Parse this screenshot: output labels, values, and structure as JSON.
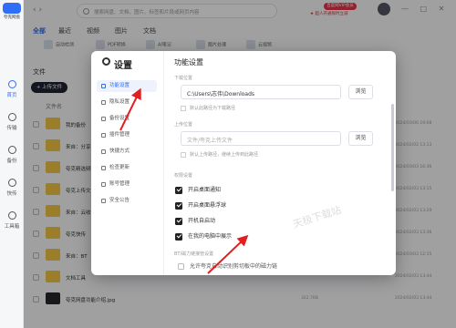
{
  "app": {
    "logo_text": "夸克网盘"
  },
  "sidebar": {
    "items": [
      {
        "label": "首页",
        "icon": "home-icon"
      },
      {
        "label": "传输",
        "icon": "transfer-icon"
      },
      {
        "label": "备份",
        "icon": "backup-icon"
      },
      {
        "label": "快传",
        "icon": "quick-share-icon"
      },
      {
        "label": "工具箱",
        "icon": "toolbox-icon"
      }
    ]
  },
  "topbar": {
    "search_placeholder": "搜索网盘、文档、图片、标签和片段或网页内容",
    "vip_badge": "百度网VIP会员",
    "promo": "★ 超人开通限时立减"
  },
  "tabs": [
    "全部",
    "最近",
    "视频",
    "图片",
    "文档"
  ],
  "chips": [
    "自动检测",
    "PDF转换",
    "AI笔记",
    "图片处理",
    "云视频"
  ],
  "files": {
    "title": "文件",
    "upload_button": "+ 上传文件",
    "column_name": "文件名",
    "rows": [
      {
        "name": "我的备份",
        "date": "2024/03/06 19:08",
        "size": ""
      },
      {
        "name": "来自：分享",
        "date": "2024/02/02 13:13",
        "size": ""
      },
      {
        "name": "夸克精选频道",
        "date": "2024/03/03 16:36",
        "size": ""
      },
      {
        "name": "夸克上传文",
        "date": "2024/02/03 13:15",
        "size": ""
      },
      {
        "name": "来自：云收",
        "date": "2024/02/03 13:29",
        "size": ""
      },
      {
        "name": "夸克快传",
        "date": "2024/02/03 13:36",
        "size": ""
      },
      {
        "name": "来自：BT",
        "date": "2024/03/03 12:15",
        "size": ""
      },
      {
        "name": "文档工具",
        "date": "2024/02/03 13:44",
        "size": ""
      },
      {
        "name": "夸克网盘功能介绍.jpg",
        "date": "2024/02/03 13:44",
        "size": "322.7KB"
      }
    ]
  },
  "dialog": {
    "title": "设置",
    "nav": [
      "功能设置",
      "隐私设置",
      "备份设置",
      "插件管理",
      "快捷方式",
      "检查更新",
      "账号管理",
      "安全公告"
    ],
    "panel_title": "功能设置",
    "download_label": "下载位置",
    "download_path": "C:\\Users\\志伟\\Downloads",
    "browse1": "浏览",
    "download_default": "默认此路径为下载路径",
    "upload_label": "上传位置",
    "upload_placeholder": "文件/夸克上传文件",
    "browse2": "浏览",
    "upload_default": "默认上传路径，继续上传到此路径",
    "perm_label": "权限设置",
    "checks": [
      "开启桌面通知",
      "开启桌面悬浮球",
      "开机自启动",
      "在我的电脑中展示"
    ],
    "bt_label": "BT/磁力链接管设置",
    "bt_option": "允许夸克自动识别剪切板中的磁力链"
  },
  "watermark": "天极下载站"
}
